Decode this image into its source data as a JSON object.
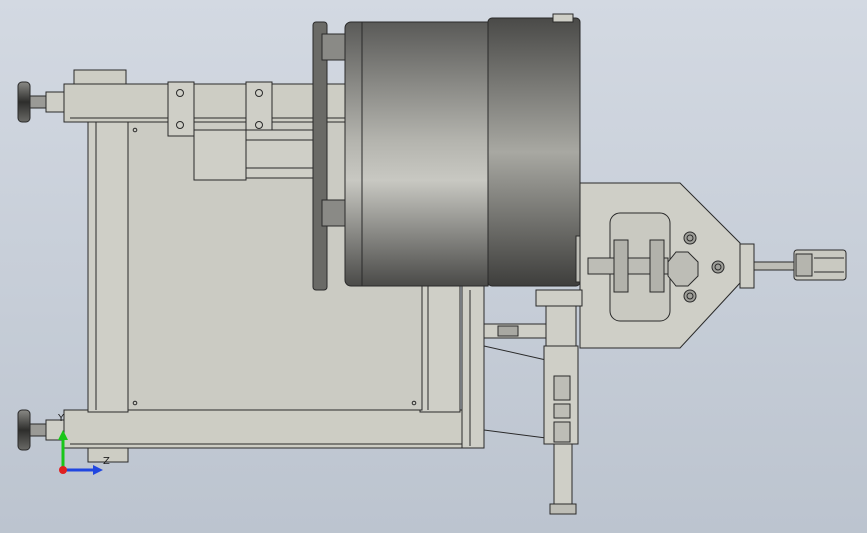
{
  "viewport": {
    "background_top": "#d3d9e2",
    "background_bottom": "#bcc4cf",
    "part_color": "#cfcfc6",
    "edge_color": "#2a2a2a"
  },
  "triad": {
    "y_label": "Y",
    "z_label": "Z",
    "y_color": "#19c619",
    "z_color": "#2046e0",
    "origin_color": "#e02020"
  }
}
